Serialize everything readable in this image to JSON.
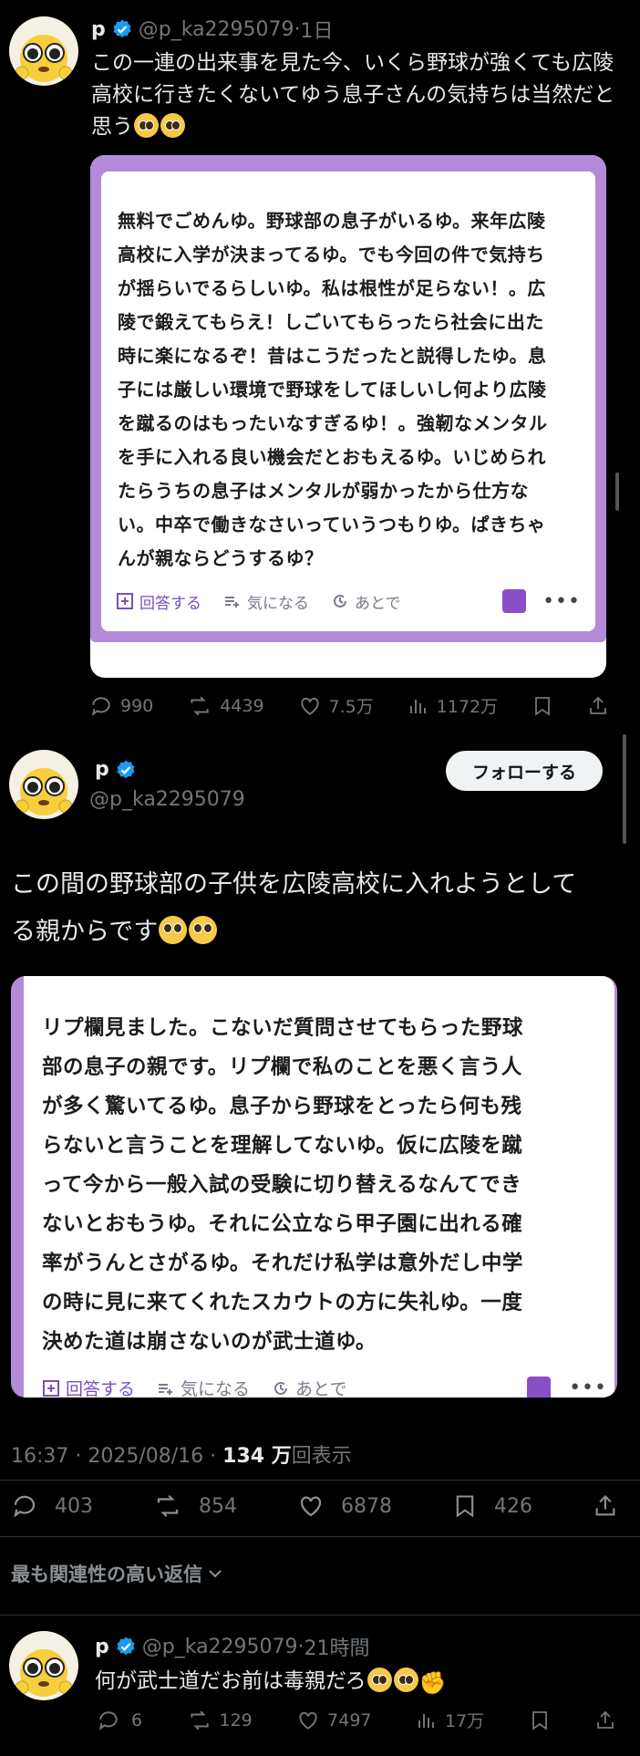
{
  "quoted_tweet": {
    "author_name": "p",
    "handle": "@p_ka2295079",
    "time": "1日",
    "text": "この一連の出来事を見た今、いくら野球が強くても広陵高校に行きたくないてゆう息子さんの気持ちは当然だと思う",
    "card": {
      "lines": [
        "無料でごめんゆ。野球部の息子がいるゆ。来年広陵",
        "高校に入学が決まってるゆ。でも今回の件で気持ち",
        "が揺らいでるらしいゆ。私は根性が足らない！。広",
        "陵で鍛えてもらえ！しごいてもらったら社会に出た",
        "時に楽になるぞ！昔はこうだったと説得したゆ。息",
        "子には厳しい環境で野球をしてほしいし何より広陵",
        "を蹴るのはもったいなすぎるゆ！。強靭なメンタル",
        "を手に入れる良い機会だとおもえるゆ。いじめられ",
        "たらうちの息子はメンタルが弱かったから仕方な",
        "い。中卒で働きなさいっていうつもりゆ。ぱきちゃ",
        "んが親ならどうするゆ？"
      ],
      "answer_label": "回答する",
      "interest_label": "気になる",
      "later_label": "あとで"
    },
    "replies": "990",
    "reposts": "4439",
    "likes": "7.5万",
    "views": "1172万"
  },
  "main_tweet": {
    "author_name": "p",
    "handle": "@p_ka2295079",
    "follow_label": "フォローする",
    "text_line1": "この間の野球部の子供を広陵高校に入れようとして",
    "text_line2": "る親からです",
    "card": {
      "lines": [
        "リプ欄見ました。こないだ質問させてもらった野球",
        "部の息子の親です。リプ欄で私のことを悪く言う人",
        "が多く驚いてるゆ。息子から野球をとったら何も残",
        "らないと言うことを理解してないゆ。仮に広陵を蹴",
        "って今から一般入試の受験に切り替えるなんてでき",
        "ないとおもうゆ。それに公立なら甲子園に出れる確",
        "率がうんとさがるゆ。それだけ私学は意外だし中学",
        "の時に見に来てくれたスカウトの方に失礼ゆ。一度",
        "決めた道は崩さないのが武士道ゆ。"
      ],
      "answer_label": "回答する",
      "interest_label": "気になる",
      "later_label": "あとで"
    },
    "timestamp": "16:37 · 2025/08/16 · ",
    "views_count": "134 万",
    "views_label": "回表示",
    "replies": "403",
    "reposts": "854",
    "likes": "6878",
    "bookmarks": "426"
  },
  "sort_label": "最も関連性の高い返信",
  "reply": {
    "author_name": "p",
    "handle": "@p_ka2295079",
    "time": "21時間",
    "text": "何が武士道だお前は毒親だろ",
    "replies": "6",
    "reposts": "129",
    "likes": "7497",
    "views": "17万"
  },
  "colors": {
    "background": "#000000",
    "verified": "#1d9bf0",
    "card_border": "#b58ad8",
    "card_accent": "#8a4fc7"
  }
}
